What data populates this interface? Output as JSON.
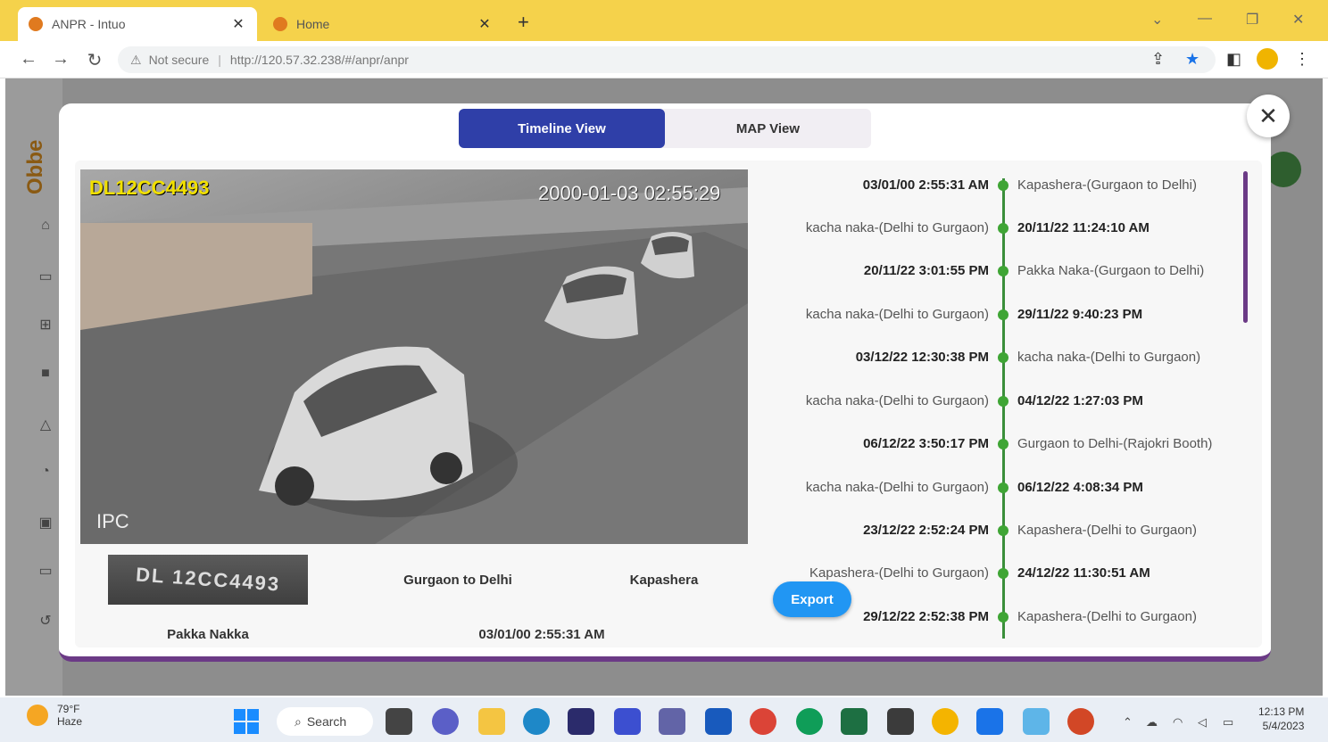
{
  "browser": {
    "tabs": [
      {
        "title": "ANPR - Intuo",
        "active": true
      },
      {
        "title": "Home",
        "active": false
      }
    ],
    "not_secure": "Not secure",
    "url": "http://120.57.32.238/#/anpr/anpr"
  },
  "modal": {
    "tabs": {
      "timeline": "Timeline View",
      "map": "MAP View"
    },
    "camera": {
      "plate_overlay": "DL12CC4493",
      "timestamp_overlay": "2000-01-03 02:55:29",
      "watermark": "IPC"
    },
    "plate_crop_text": "DL 12CC4493",
    "details": {
      "direction": "Gurgaon to Delhi",
      "location": "Kapashera",
      "site": "Pakka Nakka",
      "datetime": "03/01/00 2:55:31 AM"
    },
    "export_label": "Export",
    "timeline": [
      {
        "left": "03/01/00 2:55:31 AM",
        "right": "Kapashera-(Gurgaon to Delhi)",
        "left_is_time": true
      },
      {
        "left": "kacha naka-(Delhi to Gurgaon)",
        "right": "20/11/22 11:24:10 AM",
        "left_is_time": false
      },
      {
        "left": "20/11/22 3:01:55 PM",
        "right": "Pakka Naka-(Gurgaon to Delhi)",
        "left_is_time": true
      },
      {
        "left": "kacha naka-(Delhi to Gurgaon)",
        "right": "29/11/22 9:40:23 PM",
        "left_is_time": false
      },
      {
        "left": "03/12/22 12:30:38 PM",
        "right": "kacha naka-(Delhi to Gurgaon)",
        "left_is_time": true
      },
      {
        "left": "kacha naka-(Delhi to Gurgaon)",
        "right": "04/12/22 1:27:03 PM",
        "left_is_time": false
      },
      {
        "left": "06/12/22 3:50:17 PM",
        "right": "Gurgaon to Delhi-(Rajokri Booth)",
        "left_is_time": true
      },
      {
        "left": "kacha naka-(Delhi to Gurgaon)",
        "right": "06/12/22 4:08:34 PM",
        "left_is_time": false
      },
      {
        "left": "23/12/22 2:52:24 PM",
        "right": "Kapashera-(Delhi to Gurgaon)",
        "left_is_time": true
      },
      {
        "left": "Kapashera-(Delhi to Gurgaon)",
        "right": "24/12/22 11:30:51 AM",
        "left_is_time": false
      },
      {
        "left": "29/12/22 2:52:38 PM",
        "right": "Kapashera-(Delhi to Gurgaon)",
        "left_is_time": true
      }
    ]
  },
  "taskbar": {
    "weather_temp": "79°F",
    "weather_desc": "Haze",
    "search_label": "Search",
    "time": "12:13 PM",
    "date": "5/4/2023"
  },
  "colors": {
    "tab_bar": "#f5d24b",
    "toggle_active": "#2f3fa8",
    "export_button": "#2196f3",
    "timeline_line": "#3b8f3b",
    "modal_accent": "#6b3a86"
  }
}
